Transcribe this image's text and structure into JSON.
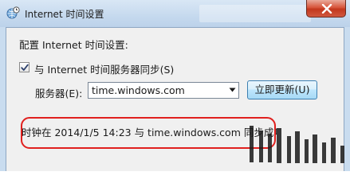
{
  "window": {
    "title": "Internet 时间设置"
  },
  "content": {
    "config_label": "配置 Internet 时间设置:",
    "sync_checkbox": {
      "label": "与 Internet 时间服务器同步(S)",
      "checked": true
    },
    "server_label": "服务器(E):",
    "server_value": "time.windows.com",
    "update_button_label": "立即更新(U)",
    "status_text": "时钟在 2014/1/5 14:23 与 time.windows.com 同步成功"
  },
  "icons": {
    "title": "globe-clock-icon",
    "close": "close-icon",
    "check": "check-icon",
    "dropdown": "chevron-down-icon"
  },
  "colors": {
    "highlight_border": "#e0201e",
    "close_button": "#c2371d",
    "button_border": "#3c7fb1"
  }
}
